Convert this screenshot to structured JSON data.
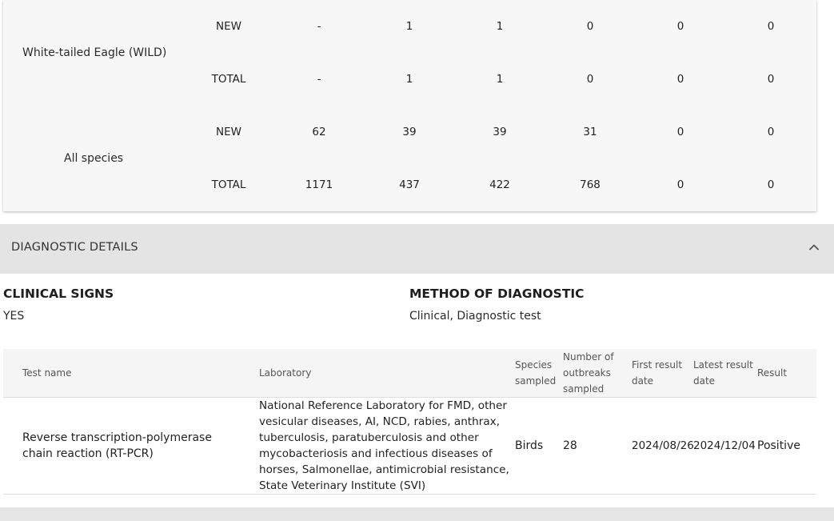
{
  "species_table": {
    "rows": [
      {
        "species": "White-tailed Eagle (WILD)",
        "lines": [
          {
            "label": "NEW",
            "values": [
              "-",
              "1",
              "1",
              "0",
              "0",
              "0"
            ]
          },
          {
            "label": "TOTAL",
            "values": [
              "-",
              "1",
              "1",
              "0",
              "0",
              "0"
            ]
          }
        ]
      },
      {
        "species": "All species",
        "lines": [
          {
            "label": "NEW",
            "values": [
              "62",
              "39",
              "39",
              "31",
              "0",
              "0"
            ]
          },
          {
            "label": "TOTAL",
            "values": [
              "1171",
              "437",
              "422",
              "768",
              "0",
              "0"
            ]
          }
        ]
      }
    ]
  },
  "diagnostic": {
    "section_title": "DIAGNOSTIC DETAILS",
    "collapse_icon": "chevron-up-icon",
    "clinical_signs": {
      "heading": "CLINICAL SIGNS",
      "value": "YES"
    },
    "method": {
      "heading": "METHOD OF DIAGNOSTIC",
      "value": "Clinical, Diagnostic test"
    },
    "tests": {
      "headers": {
        "test_name": "Test name",
        "laboratory": "Laboratory",
        "species_sampled": "Species sampled",
        "outbreaks_sampled": "Number of outbreaks sampled",
        "first_result": "First result date",
        "latest_result": "Latest result date",
        "result": "Result"
      },
      "rows": [
        {
          "test_name": "Reverse transcription-polymerase chain reaction (RT-PCR)",
          "laboratory": "National Reference Laboratory for FMD, other vesicular diseases, AI, NCD, rabies, anthrax, tuberculosis, paratuberculosis and other mycobacteriosis and infectious diseases of horses, Salmonellae, antimicrobial resistance, State Veterinary Institute (SVI)",
          "species_sampled": "Birds",
          "outbreaks_sampled": "28",
          "first_result": "2024/08/26",
          "latest_result": "2024/12/04",
          "result": "Positive"
        }
      ]
    }
  }
}
